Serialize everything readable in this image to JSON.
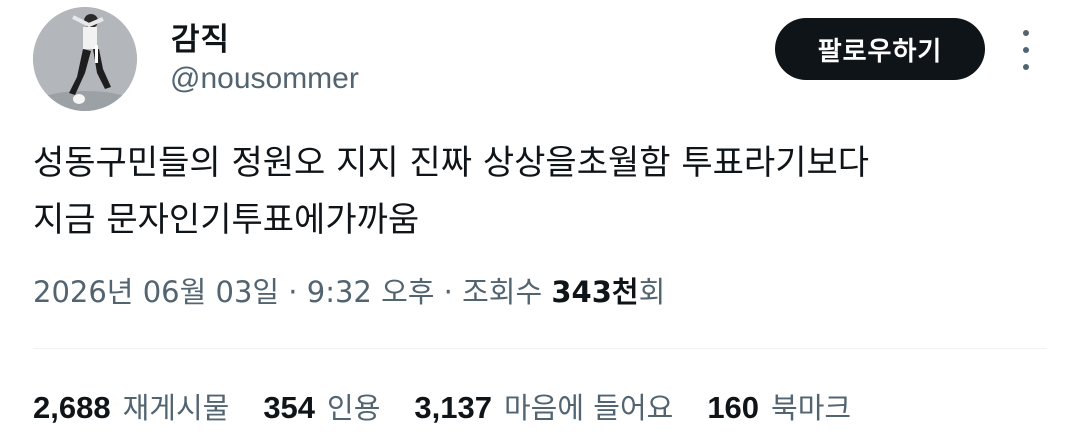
{
  "user": {
    "display_name": "감직",
    "handle": "@nousommer"
  },
  "follow_button": {
    "label": "팔로우하기"
  },
  "more_icon": "more-vertical-icon",
  "tweet": {
    "text": "성동구민들의 정원오 지지 진짜 상상을초월함 투표라기보다\n지금 문자인기투표에가까움",
    "date": "2026년 06월 03일",
    "time": "9:32 오후",
    "separator": " · ",
    "views_label": "조회수",
    "views_count": "343천",
    "views_unit": "회"
  },
  "stats": [
    {
      "count": "2,688",
      "label": "재게시물"
    },
    {
      "count": "354",
      "label": "인용"
    },
    {
      "count": "3,137",
      "label": "마음에 들어요"
    },
    {
      "count": "160",
      "label": "북마크"
    }
  ],
  "colors": {
    "text_primary": "#0f1419",
    "text_secondary": "#536471",
    "button_bg": "#0f1419",
    "divider": "#eff3f4"
  }
}
